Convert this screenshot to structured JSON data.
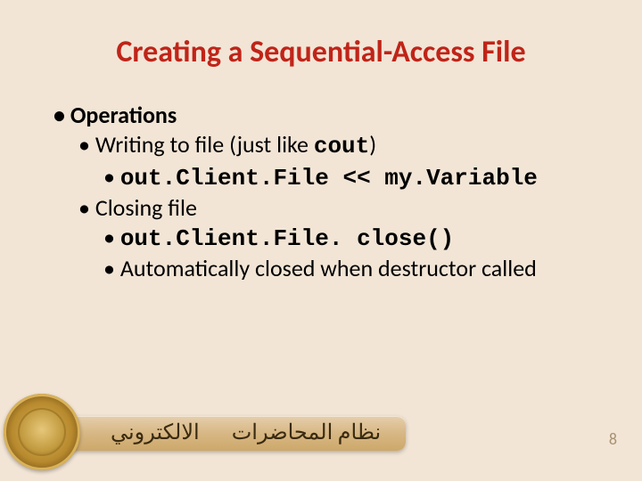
{
  "title": "Creating a Sequential-Access File",
  "content": {
    "l1_operations": "Operations",
    "l2_writing_pre": "Writing to file (just like ",
    "l2_writing_code": "cout",
    "l2_writing_post": ")",
    "l3_write_code": "out.Client.File << my.Variable",
    "l2_closing": "Closing file",
    "l3_close_code": "out.Client.File. close()",
    "l3_auto": "Automatically closed when destructor called"
  },
  "footer": {
    "banner_right": "نظام المحاضرات",
    "banner_left": "الالكتروني",
    "page_number": "8"
  }
}
